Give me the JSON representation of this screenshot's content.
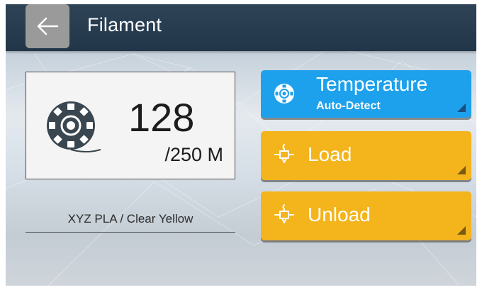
{
  "header": {
    "title": "Filament",
    "back_icon": "arrow-left-icon"
  },
  "filament": {
    "spool_icon": "filament-spool-icon",
    "remaining": "128",
    "total": "/250 M",
    "material": "XYZ PLA / Clear Yellow"
  },
  "actions": {
    "temperature": {
      "label": "Temperature",
      "sub_label": "Auto-Detect",
      "icon": "filament-spool-icon",
      "color": "#1da1ec"
    },
    "load": {
      "label": "Load",
      "icon": "nozzle-icon",
      "color": "#f3b41c"
    },
    "unload": {
      "label": "Unload",
      "icon": "nozzle-icon",
      "color": "#f3b41c"
    }
  },
  "colors": {
    "header_bg": "#22364a",
    "accent_blue": "#1da1ec",
    "accent_yellow": "#f3b41c"
  }
}
